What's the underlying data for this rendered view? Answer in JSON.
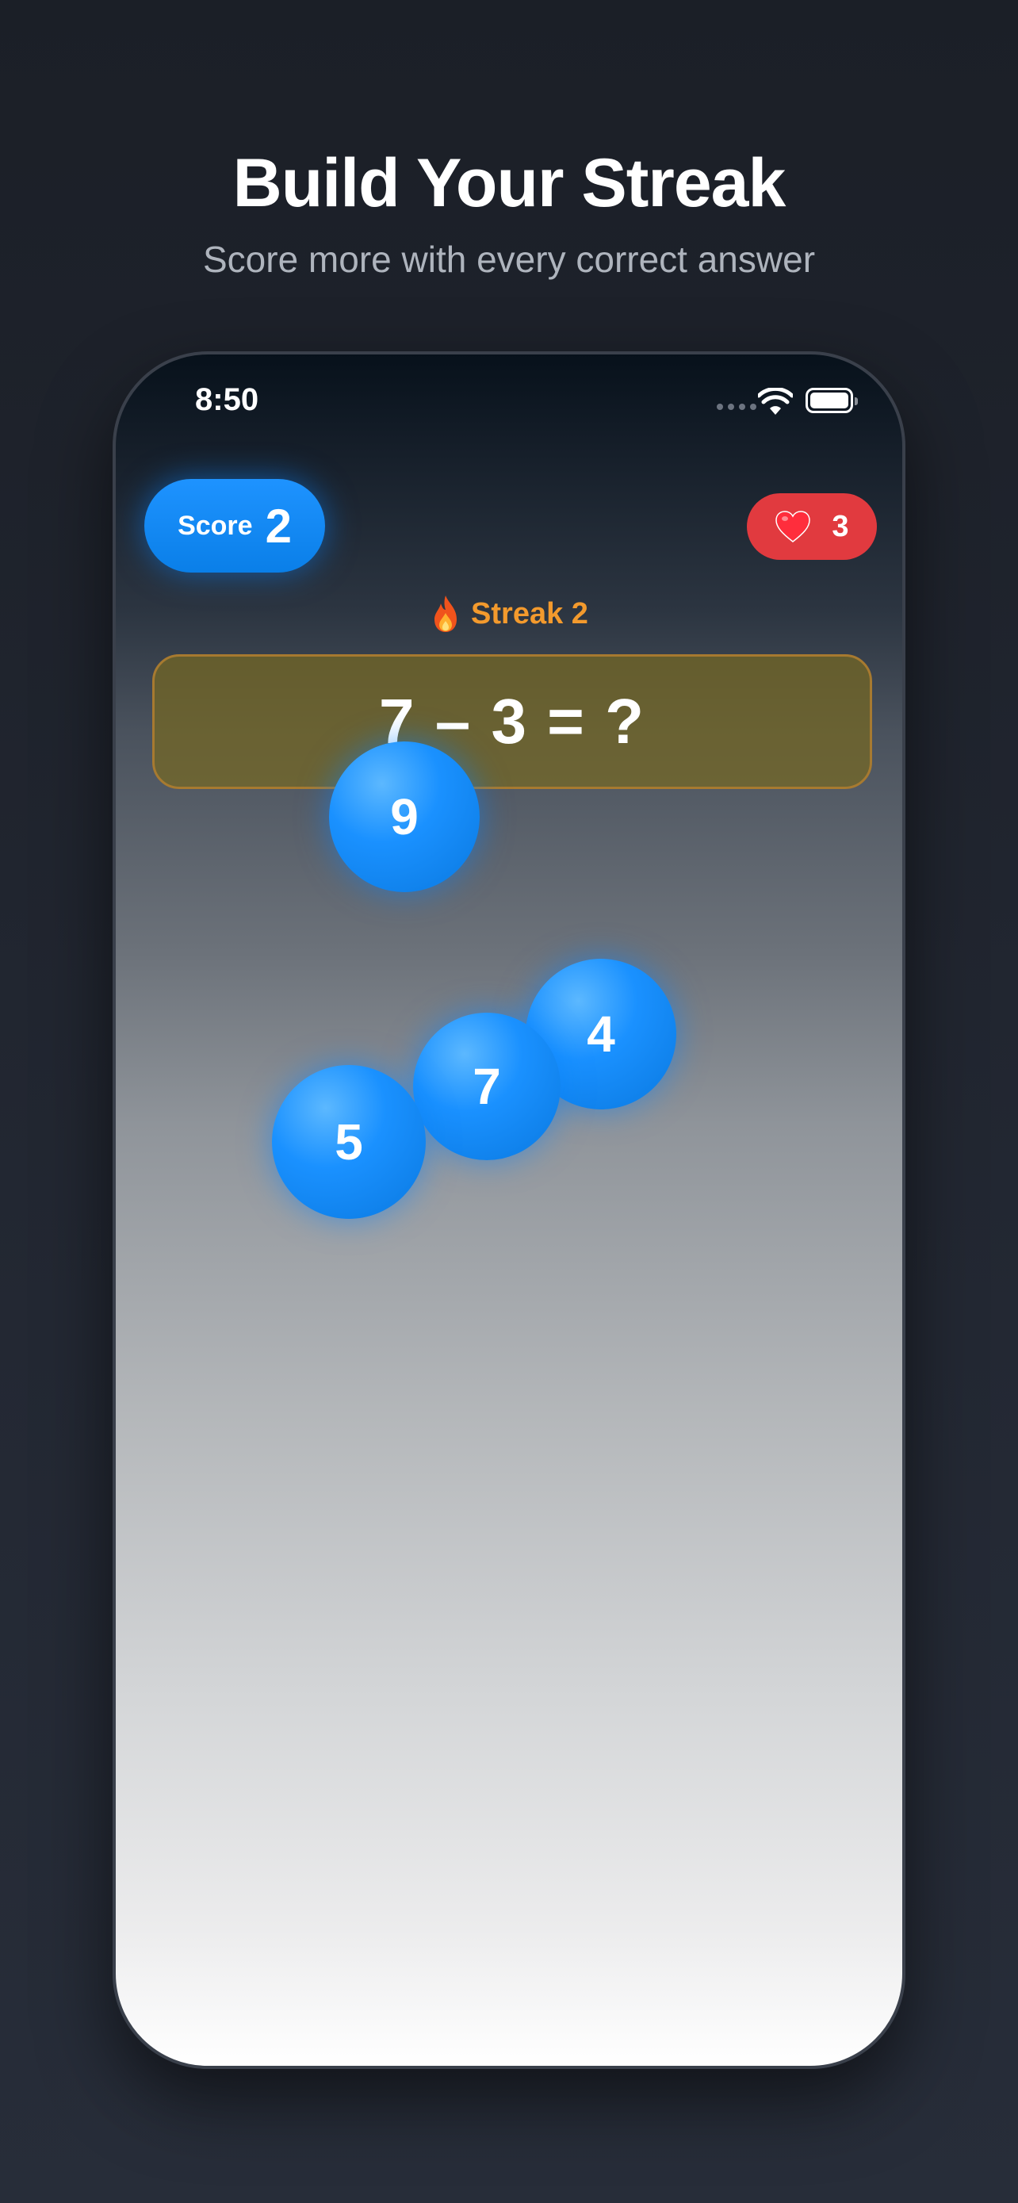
{
  "header": {
    "title": "Build Your Streak",
    "subtitle": "Score more with every correct answer"
  },
  "status_bar": {
    "time": "8:50"
  },
  "game": {
    "score_label": "Score",
    "score_value": "2",
    "lives_value": "3",
    "streak_text": "Streak 2",
    "question": "7 – 3 = ?",
    "answer_bubbles": [
      "9",
      "4",
      "7",
      "5"
    ]
  },
  "colors": {
    "accent_blue": "#0A84FF",
    "lives_red": "#E13A3F",
    "streak_orange": "#F39A2D",
    "question_box": "#76682A"
  },
  "icons": {
    "lives": "heart-icon",
    "streak": "flame-icon",
    "wifi": "wifi-icon",
    "battery": "battery-icon"
  }
}
